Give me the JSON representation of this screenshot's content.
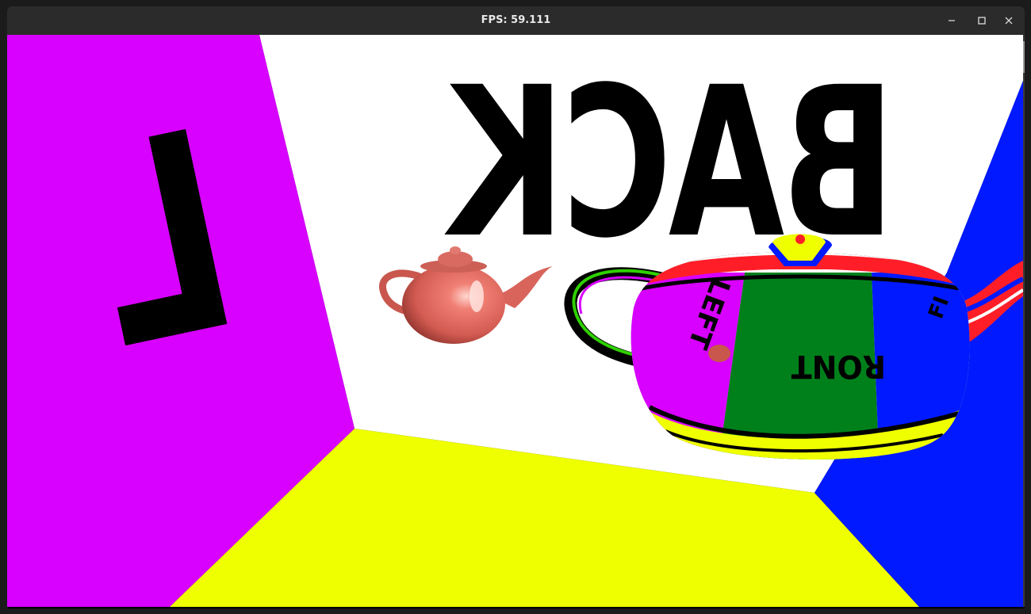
{
  "window": {
    "title": "FPS: 59.111",
    "controls": {
      "minimize": "minimize-icon",
      "maximize": "maximize-icon",
      "close": "close-icon"
    }
  },
  "scene": {
    "back_wall_text": "BACK",
    "left_wall_text": "L",
    "teapot_label_left": "LEFT",
    "teapot_label_front": "RONT",
    "teapot_label_side": "FI",
    "colors": {
      "left_wall": "#d800ff",
      "back_wall": "#ffffff",
      "floor": "#efff00",
      "right_wall": "#0019ff",
      "teapot_small": "#e06b62",
      "front_face": "#00801b",
      "text": "#000000"
    }
  }
}
